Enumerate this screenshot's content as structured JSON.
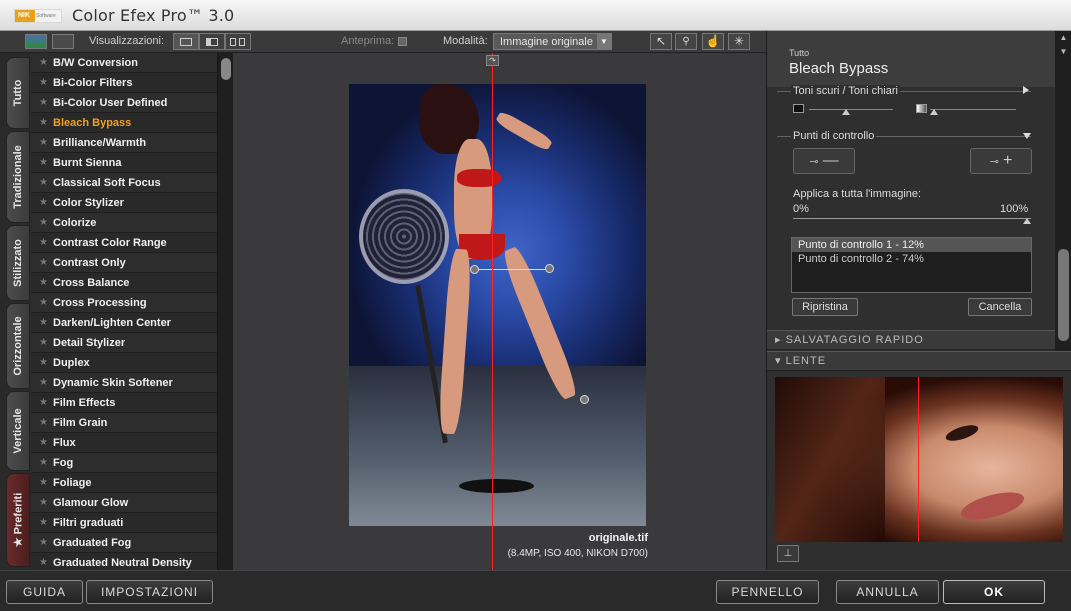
{
  "app": {
    "title": "Color Efex Pro™ 3.0",
    "logo": {
      "brand": "NIK",
      "sub": "Software"
    }
  },
  "toolbar": {
    "views_label": "Visualizzazioni:",
    "preview_label": "Anteprima:",
    "mode_label": "Modalità:",
    "mode_value": "Immagine originale",
    "tools": [
      {
        "icon": "arrow-pointer-icon",
        "glyph": "↖"
      },
      {
        "icon": "zoom-icon",
        "glyph": "🔍"
      },
      {
        "icon": "hand-icon",
        "glyph": "✋"
      },
      {
        "icon": "light-icon",
        "glyph": "✳"
      }
    ]
  },
  "side_tabs": [
    "Tutto",
    "Tradizionale",
    "Stilizzato",
    "Orizzontale",
    "Verticale",
    "Preferiti"
  ],
  "filters": {
    "selected": "Bleach Bypass",
    "items": [
      "B/W Conversion",
      "Bi-Color Filters",
      "Bi-Color User Defined",
      "Bleach Bypass",
      "Brilliance/Warmth",
      "Burnt Sienna",
      "Classical Soft Focus",
      "Color Stylizer",
      "Colorize",
      "Contrast Color Range",
      "Contrast Only",
      "Cross Balance",
      "Cross Processing",
      "Darken/Lighten Center",
      "Detail Stylizer",
      "Duplex",
      "Dynamic Skin Softener",
      "Film Effects",
      "Film Grain",
      "Flux",
      "Fog",
      "Foliage",
      "Glamour Glow",
      "Filtri graduati",
      "Graduated Fog",
      "Graduated Neutral Density"
    ]
  },
  "preview": {
    "filename": "originale.tif",
    "info": "(8.4MP, ISO 400, NIKON D700)"
  },
  "panel": {
    "category": "Tutto",
    "filter_name": "Bleach Bypass",
    "tones_label": "Toni scuri / Toni chiari",
    "control_points_label": "Punti di controllo",
    "apply_label": "Applica a tutta l'immagine:",
    "apply_min": "0%",
    "apply_max": "100%",
    "apply_value_percent": 100,
    "control_points": [
      "Punto di controllo 1 - 12%",
      "Punto di controllo 2 - 74%"
    ],
    "reset_label": "Ripristina",
    "delete_label": "Cancella",
    "quick_save_label": "SALVATAGGIO RAPIDO",
    "lens_label": "LENTE"
  },
  "bottom": {
    "help": "GUIDA",
    "settings": "IMPOSTAZIONI",
    "brush": "PENNELLO",
    "cancel": "ANNULLA",
    "ok": "OK"
  }
}
